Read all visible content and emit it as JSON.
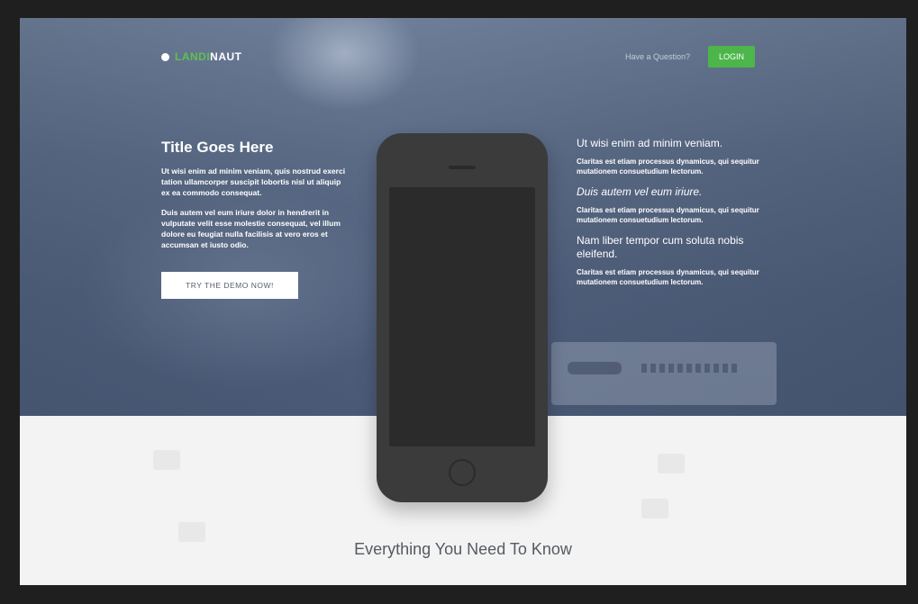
{
  "brand": {
    "logo_part1": "LANDI",
    "logo_part2": "NAUT",
    "accent_color": "#4cb64a"
  },
  "nav": {
    "link_label": "Have a Question?",
    "button_label": "LOGIN"
  },
  "hero": {
    "title": "Title Goes Here",
    "paragraph1": "Ut wisi enim ad minim veniam, quis nostrud exerci tation ullamcorper suscipit lobortis nisl ut aliquip ex ea commodo consequat.",
    "paragraph2": "Duis autem vel eum iriure dolor in hendrerit in vulputate velit esse molestie consequat, vel illum dolore eu feugiat nulla facilisis at vero eros et accumsan et iusto odio.",
    "cta_label": "TRY THE DEMO NOW!"
  },
  "features": [
    {
      "heading": "Ut wisi enim ad minim veniam.",
      "text": "Claritas est etiam processus dynamicus, qui sequitur mutationem consuetudium lectorum."
    },
    {
      "heading": "Duis autem vel eum iriure.",
      "text": "Claritas est etiam processus dynamicus, qui sequitur mutationem consuetudium lectorum."
    },
    {
      "heading": "Nam liber tempor cum soluta nobis eleifend.",
      "text": "Claritas est etiam processus dynamicus, qui sequitur mutationem consuetudium lectorum."
    }
  ],
  "section": {
    "title": "Everything You Need To Know"
  },
  "icons": {
    "logo": "circle-logo-icon",
    "phone": "smartphone-mockup"
  }
}
